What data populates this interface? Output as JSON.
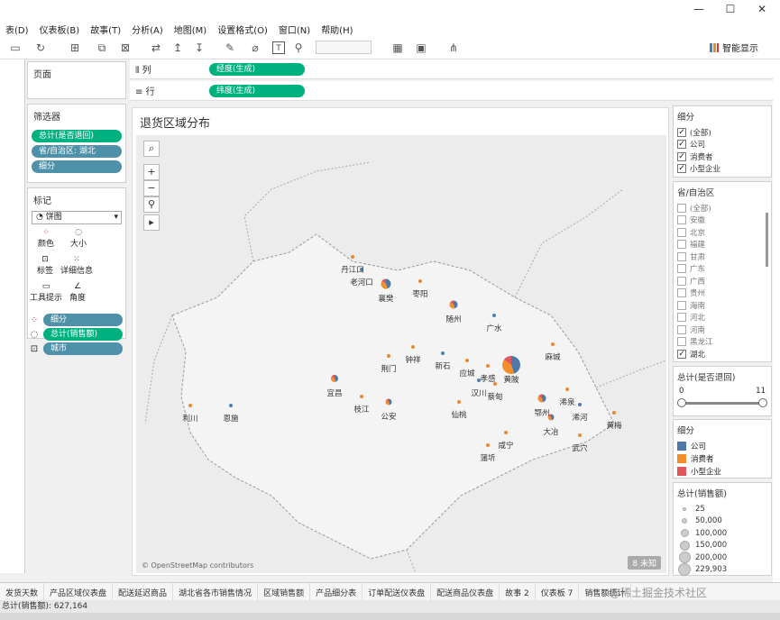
{
  "window": {
    "min": "—",
    "max": "☐",
    "close": "✕"
  },
  "menu": [
    "表(D)",
    "仪表板(B)",
    "故事(T)",
    "分析(A)",
    "地图(M)",
    "设置格式(O)",
    "窗口(N)",
    "帮助(H)"
  ],
  "toolbar": {
    "smart_show": "智能显示"
  },
  "left": {
    "pages_title": "页面",
    "filters_title": "筛选器",
    "filters": [
      "总计(是否退回)",
      "省/自治区: 湖北",
      "细分"
    ],
    "marks_title": "标记",
    "mark_type": "饼图",
    "mark_buttons": [
      "颜色",
      "大小",
      "标签",
      "详细信息",
      "工具提示",
      "角度"
    ],
    "mark_fields": [
      "细分",
      "总计(销售额)",
      "城市"
    ]
  },
  "shelves": {
    "columns_label": "列",
    "columns_pill": "经度(生成)",
    "rows_label": "行",
    "rows_pill": "纬度(生成)"
  },
  "viz": {
    "title": "退货区域分布",
    "attribution": "© OpenStreetMap contributors",
    "unknown": "8 未知",
    "cities": [
      {
        "name": "丹江口",
        "pie": false
      },
      {
        "name": "老河口",
        "pie": false
      },
      {
        "name": "襄樊",
        "pie": true
      },
      {
        "name": "枣阳",
        "pie": false
      },
      {
        "name": "随州",
        "pie": true
      },
      {
        "name": "广水",
        "pie": false
      },
      {
        "name": "麻城",
        "pie": false
      },
      {
        "name": "钟祥",
        "pie": false
      },
      {
        "name": "荆门",
        "pie": false
      },
      {
        "name": "新石",
        "pie": false
      },
      {
        "name": "应城",
        "pie": false
      },
      {
        "name": "孝感",
        "pie": false
      },
      {
        "name": "黄陂",
        "pie": true
      },
      {
        "name": "汉川",
        "pie": false
      },
      {
        "name": "蔡甸",
        "pie": false
      },
      {
        "name": "宜昌",
        "pie": true
      },
      {
        "name": "枝江",
        "pie": false
      },
      {
        "name": "公安",
        "pie": true
      },
      {
        "name": "仙桃",
        "pie": false
      },
      {
        "name": "鄂州",
        "pie": true
      },
      {
        "name": "浠泉",
        "pie": false
      },
      {
        "name": "浠河",
        "pie": false
      },
      {
        "name": "大冶",
        "pie": true
      },
      {
        "name": "黄梅",
        "pie": false
      },
      {
        "name": "利川",
        "pie": false
      },
      {
        "name": "恩施",
        "pie": false
      },
      {
        "name": "咸宁",
        "pie": false
      },
      {
        "name": "蒲圻",
        "pie": false
      },
      {
        "name": "武穴",
        "pie": false
      }
    ]
  },
  "right": {
    "segment_title": "细分",
    "segment_items": [
      "(全部)",
      "公司",
      "消费者",
      "小型企业"
    ],
    "province_title": "省/自治区",
    "province_items": [
      "(全部)",
      "安徽",
      "北京",
      "福建",
      "甘肃",
      "广东",
      "广西",
      "贵州",
      "海南",
      "河北",
      "河南",
      "黑龙江",
      "湖北"
    ],
    "province_checked": "湖北",
    "returned_title": "总计(是否退回)",
    "returned_min": "0",
    "returned_max": "11",
    "legend_title": "细分",
    "legend": [
      {
        "label": "公司",
        "color": "#4e79a7"
      },
      {
        "label": "消费者",
        "color": "#f28e2b"
      },
      {
        "label": "小型企业",
        "color": "#e15759"
      }
    ],
    "size_title": "总计(销售额)",
    "sizes": [
      "25",
      "50,000",
      "100,000",
      "150,000",
      "200,000",
      "229,903"
    ]
  },
  "tabs": [
    "发货天数",
    "产品区域仪表盘",
    "配送延迟商品",
    "湖北省各市销售情况",
    "区域销售额",
    "产品细分表",
    "订单配送仪表盘",
    "配送商品仪表盘",
    "故事 2",
    "仪表板 7",
    "销售额统计"
  ],
  "status": "总计(销售额): 627,164",
  "watermark": "@稀土掘金技术社区"
}
